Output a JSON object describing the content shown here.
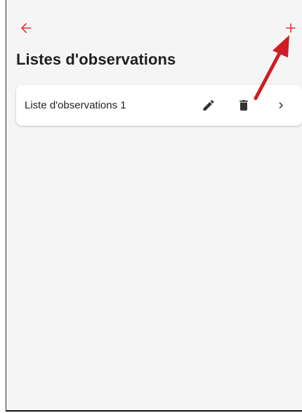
{
  "header": {
    "title": "Listes d'observations",
    "back_icon": "arrow-left-icon",
    "add_icon": "plus-icon"
  },
  "lists": [
    {
      "label": "Liste d'observations 1",
      "edit_icon": "pencil-icon",
      "delete_icon": "trash-icon",
      "open_icon": "chevron-right-icon"
    }
  ],
  "colors": {
    "accent": "#e8414b",
    "background": "#f5f5f5",
    "card": "#ffffff",
    "icon": "#333333",
    "annotation_arrow": "#d01c24"
  }
}
